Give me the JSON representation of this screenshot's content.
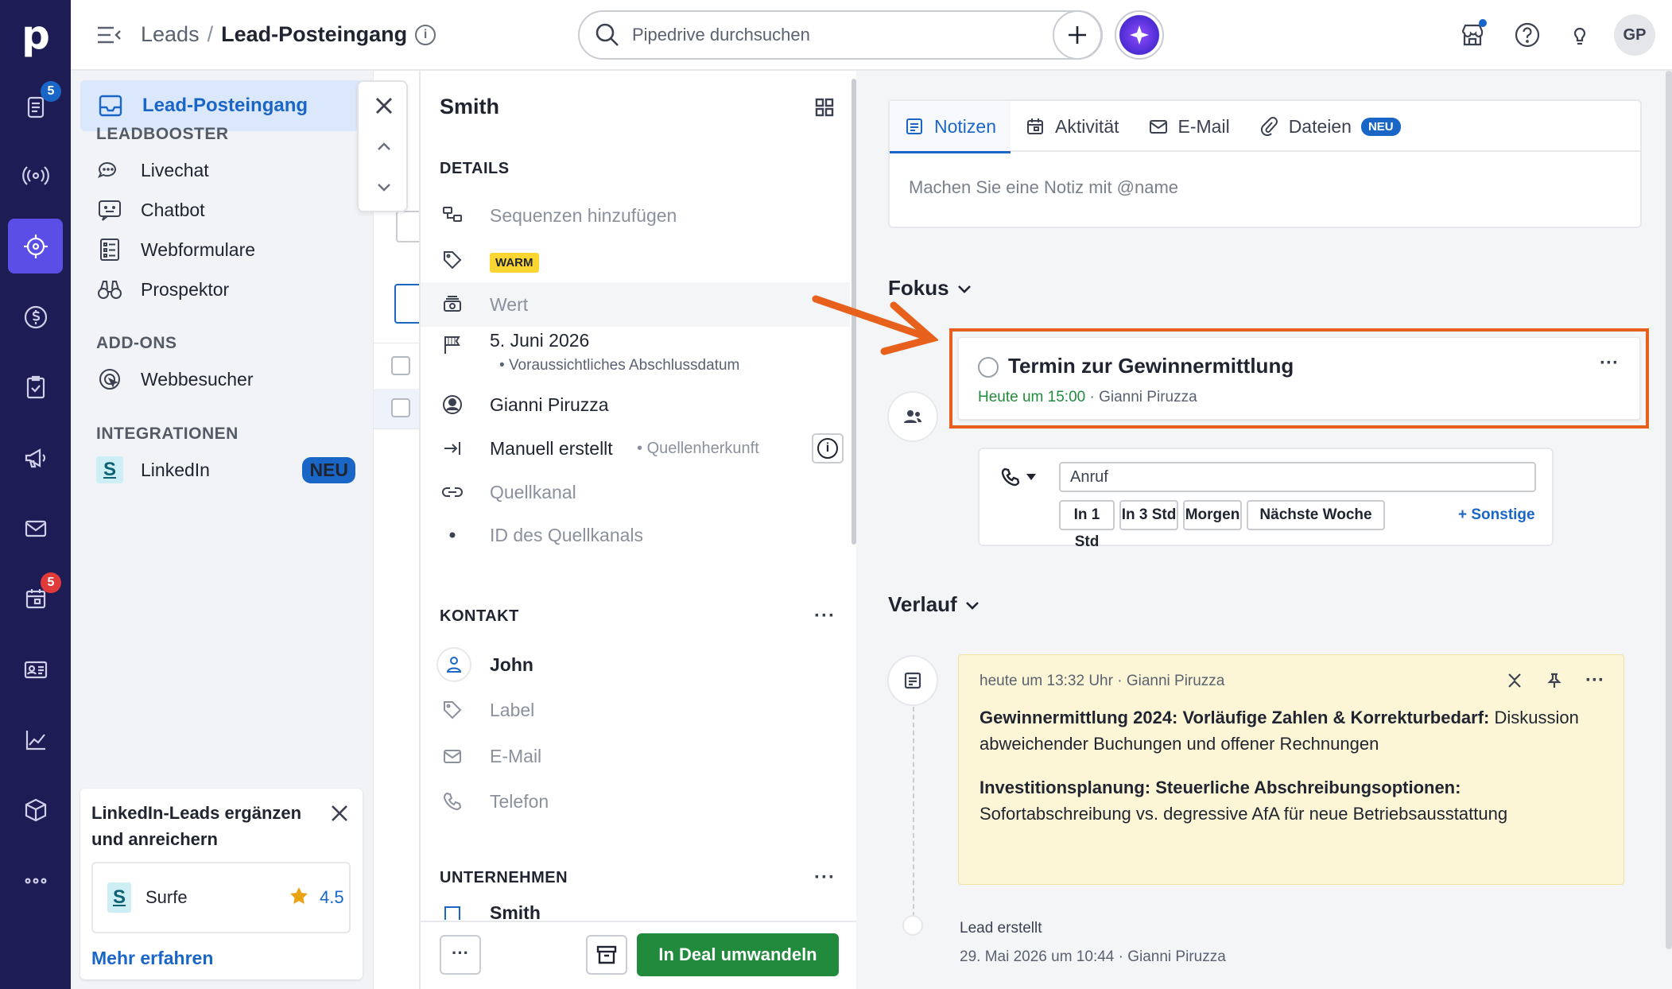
{
  "rail": {
    "logo": "p",
    "items": [
      {
        "name": "leads-docs-icon",
        "badge": "5",
        "badge_color": "#1a66c7"
      },
      {
        "name": "broadcast-icon"
      },
      {
        "name": "target-icon",
        "active": true
      },
      {
        "name": "dollar-icon"
      },
      {
        "name": "clipboard-check-icon"
      },
      {
        "name": "megaphone-icon"
      },
      {
        "name": "mail-icon"
      },
      {
        "name": "calendar-icon",
        "badge": "5",
        "badge_color": "#e03a3a"
      },
      {
        "name": "contact-card-icon"
      },
      {
        "name": "chart-icon"
      },
      {
        "name": "box-icon"
      },
      {
        "name": "more-icon"
      }
    ]
  },
  "header": {
    "breadcrumb_parent": "Leads",
    "breadcrumb_sep": "/",
    "breadcrumb_current": "Lead-Posteingang",
    "info": "i",
    "search_placeholder": "Pipedrive durchsuchen",
    "add_label": "+",
    "avatar_initials": "GP"
  },
  "sidebar": {
    "active_item": "Lead-Posteingang",
    "section_leadbooster": "LEADBOOSTER",
    "leadbooster_items": [
      "Livechat",
      "Chatbot",
      "Webformulare",
      "Prospektor"
    ],
    "section_addons": "ADD-ONS",
    "addons_items": [
      "Webbesucher"
    ],
    "section_integrations": "INTEGRATIONEN",
    "integration_item": "LinkedIn",
    "integration_badge": "NEU",
    "promo": {
      "title": "LinkedIn-Leads ergänzen und anreichern",
      "app_name": "Surfe",
      "rating": "4.5",
      "more_link": "Mehr erfahren"
    }
  },
  "details": {
    "title": "Smith",
    "section_details": "DETAILS",
    "sequences": "Sequenzen hinzufügen",
    "tag": "WARM",
    "value_label": "Wert",
    "close_date": "5. Juni 2026",
    "close_date_sub": "Voraussichtliches Abschlussdatum",
    "owner": "Gianni Piruzza",
    "source_origin": "Manuell erstellt",
    "source_origin_label": "Quellenherkunft",
    "source_channel": "Quellkanal",
    "source_channel_id": "ID des Quellkanals",
    "section_contact": "KONTAKT",
    "contact_name": "John",
    "contact_label": "Label",
    "contact_email": "E-Mail",
    "contact_phone": "Telefon",
    "section_company": "UNTERNEHMEN",
    "company_name_partial": "Smith",
    "dots": "···",
    "convert_button": "In Deal umwandeln"
  },
  "composer": {
    "tabs": [
      {
        "label": "Notizen",
        "icon": "note-icon",
        "active": true
      },
      {
        "label": "Aktivität",
        "icon": "calendar-icon"
      },
      {
        "label": "E-Mail",
        "icon": "mail-icon"
      },
      {
        "label": "Dateien",
        "icon": "paperclip-icon",
        "badge": "NEU"
      }
    ],
    "placeholder": "Machen Sie eine Notiz mit @name"
  },
  "focus": {
    "heading": "Fokus",
    "activity_title": "Termin zur Gewinnermittlung",
    "activity_time": "Heute um 15:00",
    "activity_sep": "·",
    "activity_owner": "Gianni Piruzza",
    "highlight_color": "#e8611c",
    "quick_input": "Anruf",
    "quick_chips": [
      "In 1 Std",
      "In 3 Std",
      "Morgen",
      "Nächste Woche"
    ],
    "quick_more": "+ Sonstige"
  },
  "history": {
    "heading": "Verlauf",
    "note_meta": "heute um 13:32 Uhr · Gianni Piruzza",
    "note_p1_bold": "Gewinnermittlung 2024: Vorläufige Zahlen & Korrekturbedarf:",
    "note_p1_text": " Diskussion abweichender Buchungen und offener Rechnungen",
    "note_p2_bold": "Investitionsplanung: Steuerliche Abschreibungsoptionen:",
    "note_p2_text": " Sofortabschreibung vs. degressive AfA für neue Betriebsausstattung",
    "created_title": "Lead erstellt",
    "created_meta": "29. Mai 2026 um 10:44 · Gianni Piruzza"
  }
}
